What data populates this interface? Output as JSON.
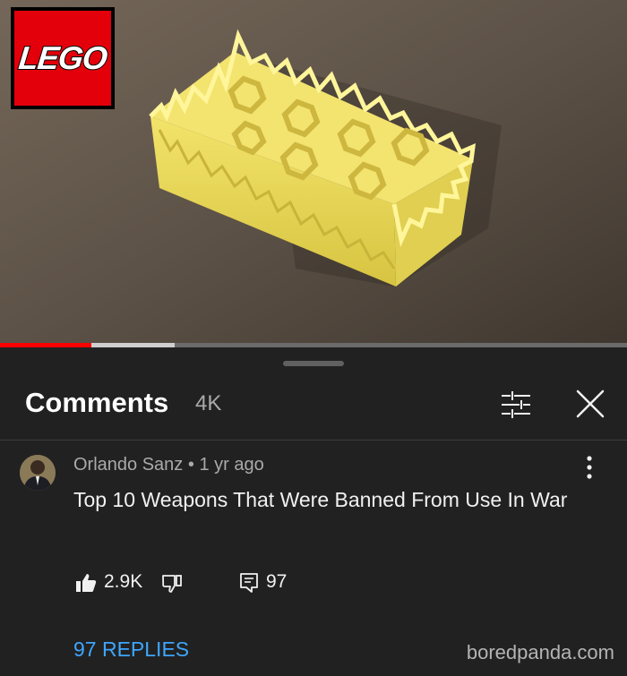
{
  "video": {
    "logo_text": "LEGO",
    "progress_played": 0.146,
    "progress_buffered": 0.279
  },
  "comments_panel": {
    "title": "Comments",
    "count": "4K"
  },
  "comment": {
    "author": "Orlando Sanz",
    "separator": "•",
    "time": "1 yr ago",
    "text": "Top 10 Weapons That Were Banned From Use In War",
    "likes": "2.9K",
    "reply_count": "97",
    "replies_link": "97 REPLIES"
  },
  "watermark": "boredpanda.com",
  "colors": {
    "accent_link": "#3ea6ff",
    "progress_red": "#ff0000",
    "background": "#212121"
  }
}
